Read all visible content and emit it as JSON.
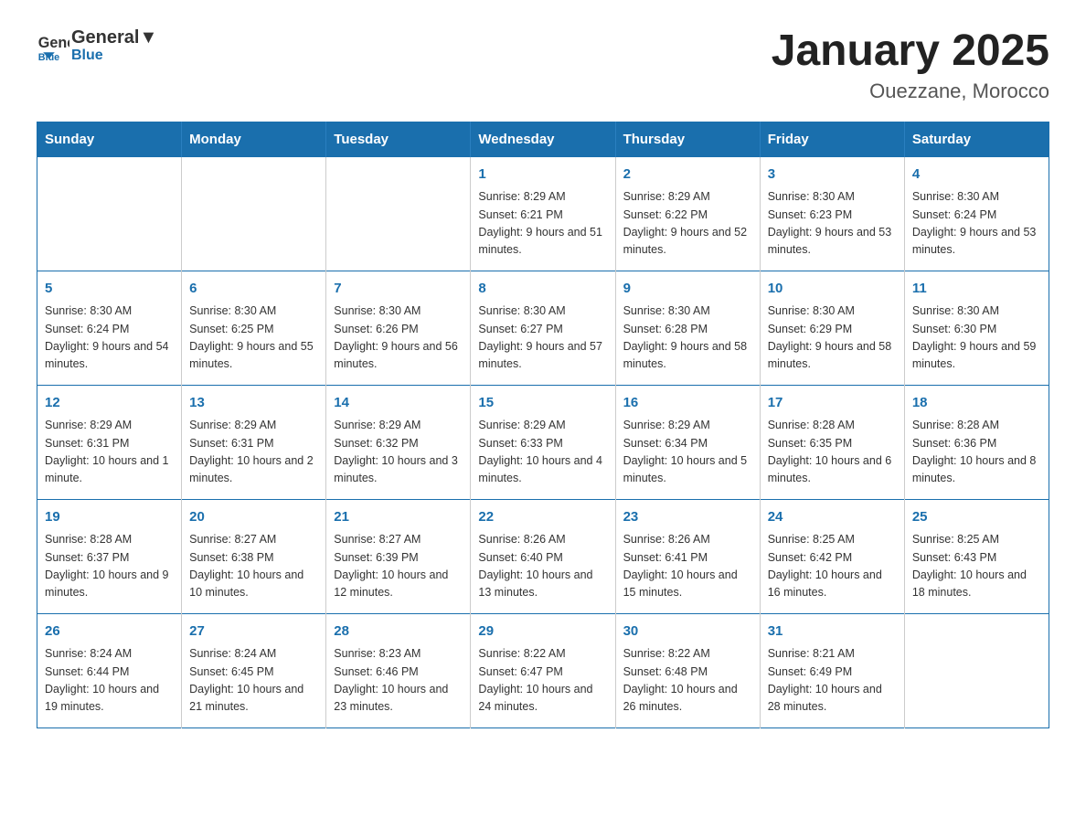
{
  "header": {
    "logo_general": "General",
    "logo_blue": "Blue",
    "title": "January 2025",
    "subtitle": "Ouezzane, Morocco"
  },
  "weekdays": [
    "Sunday",
    "Monday",
    "Tuesday",
    "Wednesday",
    "Thursday",
    "Friday",
    "Saturday"
  ],
  "weeks": [
    [
      {
        "day": "",
        "info": ""
      },
      {
        "day": "",
        "info": ""
      },
      {
        "day": "",
        "info": ""
      },
      {
        "day": "1",
        "info": "Sunrise: 8:29 AM\nSunset: 6:21 PM\nDaylight: 9 hours and 51 minutes."
      },
      {
        "day": "2",
        "info": "Sunrise: 8:29 AM\nSunset: 6:22 PM\nDaylight: 9 hours and 52 minutes."
      },
      {
        "day": "3",
        "info": "Sunrise: 8:30 AM\nSunset: 6:23 PM\nDaylight: 9 hours and 53 minutes."
      },
      {
        "day": "4",
        "info": "Sunrise: 8:30 AM\nSunset: 6:24 PM\nDaylight: 9 hours and 53 minutes."
      }
    ],
    [
      {
        "day": "5",
        "info": "Sunrise: 8:30 AM\nSunset: 6:24 PM\nDaylight: 9 hours and 54 minutes."
      },
      {
        "day": "6",
        "info": "Sunrise: 8:30 AM\nSunset: 6:25 PM\nDaylight: 9 hours and 55 minutes."
      },
      {
        "day": "7",
        "info": "Sunrise: 8:30 AM\nSunset: 6:26 PM\nDaylight: 9 hours and 56 minutes."
      },
      {
        "day": "8",
        "info": "Sunrise: 8:30 AM\nSunset: 6:27 PM\nDaylight: 9 hours and 57 minutes."
      },
      {
        "day": "9",
        "info": "Sunrise: 8:30 AM\nSunset: 6:28 PM\nDaylight: 9 hours and 58 minutes."
      },
      {
        "day": "10",
        "info": "Sunrise: 8:30 AM\nSunset: 6:29 PM\nDaylight: 9 hours and 58 minutes."
      },
      {
        "day": "11",
        "info": "Sunrise: 8:30 AM\nSunset: 6:30 PM\nDaylight: 9 hours and 59 minutes."
      }
    ],
    [
      {
        "day": "12",
        "info": "Sunrise: 8:29 AM\nSunset: 6:31 PM\nDaylight: 10 hours and 1 minute."
      },
      {
        "day": "13",
        "info": "Sunrise: 8:29 AM\nSunset: 6:31 PM\nDaylight: 10 hours and 2 minutes."
      },
      {
        "day": "14",
        "info": "Sunrise: 8:29 AM\nSunset: 6:32 PM\nDaylight: 10 hours and 3 minutes."
      },
      {
        "day": "15",
        "info": "Sunrise: 8:29 AM\nSunset: 6:33 PM\nDaylight: 10 hours and 4 minutes."
      },
      {
        "day": "16",
        "info": "Sunrise: 8:29 AM\nSunset: 6:34 PM\nDaylight: 10 hours and 5 minutes."
      },
      {
        "day": "17",
        "info": "Sunrise: 8:28 AM\nSunset: 6:35 PM\nDaylight: 10 hours and 6 minutes."
      },
      {
        "day": "18",
        "info": "Sunrise: 8:28 AM\nSunset: 6:36 PM\nDaylight: 10 hours and 8 minutes."
      }
    ],
    [
      {
        "day": "19",
        "info": "Sunrise: 8:28 AM\nSunset: 6:37 PM\nDaylight: 10 hours and 9 minutes."
      },
      {
        "day": "20",
        "info": "Sunrise: 8:27 AM\nSunset: 6:38 PM\nDaylight: 10 hours and 10 minutes."
      },
      {
        "day": "21",
        "info": "Sunrise: 8:27 AM\nSunset: 6:39 PM\nDaylight: 10 hours and 12 minutes."
      },
      {
        "day": "22",
        "info": "Sunrise: 8:26 AM\nSunset: 6:40 PM\nDaylight: 10 hours and 13 minutes."
      },
      {
        "day": "23",
        "info": "Sunrise: 8:26 AM\nSunset: 6:41 PM\nDaylight: 10 hours and 15 minutes."
      },
      {
        "day": "24",
        "info": "Sunrise: 8:25 AM\nSunset: 6:42 PM\nDaylight: 10 hours and 16 minutes."
      },
      {
        "day": "25",
        "info": "Sunrise: 8:25 AM\nSunset: 6:43 PM\nDaylight: 10 hours and 18 minutes."
      }
    ],
    [
      {
        "day": "26",
        "info": "Sunrise: 8:24 AM\nSunset: 6:44 PM\nDaylight: 10 hours and 19 minutes."
      },
      {
        "day": "27",
        "info": "Sunrise: 8:24 AM\nSunset: 6:45 PM\nDaylight: 10 hours and 21 minutes."
      },
      {
        "day": "28",
        "info": "Sunrise: 8:23 AM\nSunset: 6:46 PM\nDaylight: 10 hours and 23 minutes."
      },
      {
        "day": "29",
        "info": "Sunrise: 8:22 AM\nSunset: 6:47 PM\nDaylight: 10 hours and 24 minutes."
      },
      {
        "day": "30",
        "info": "Sunrise: 8:22 AM\nSunset: 6:48 PM\nDaylight: 10 hours and 26 minutes."
      },
      {
        "day": "31",
        "info": "Sunrise: 8:21 AM\nSunset: 6:49 PM\nDaylight: 10 hours and 28 minutes."
      },
      {
        "day": "",
        "info": ""
      }
    ]
  ]
}
